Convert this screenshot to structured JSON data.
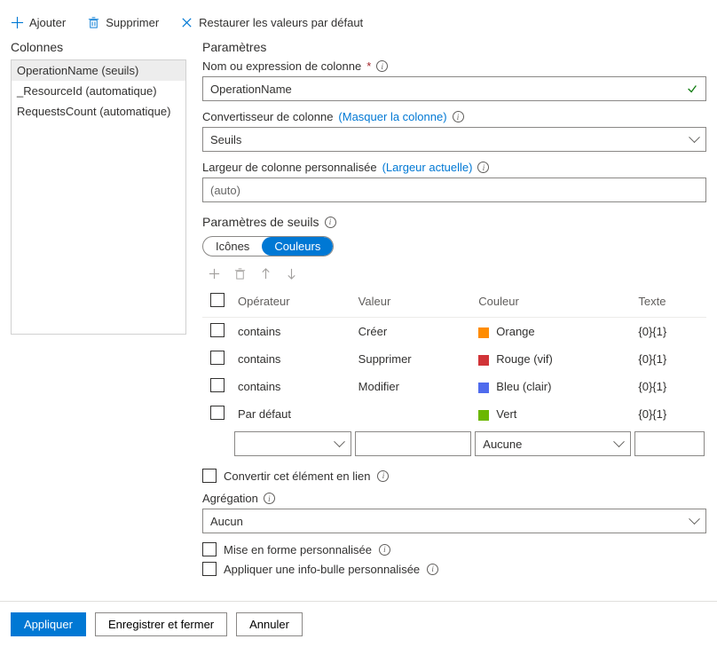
{
  "toolbar": {
    "add_label": "Ajouter",
    "delete_label": "Supprimer",
    "reset_label": "Restaurer les valeurs par défaut"
  },
  "left": {
    "title": "Colonnes",
    "items": [
      {
        "label": "OperationName (seuils)"
      },
      {
        "label": "_ResourceId (automatique)"
      },
      {
        "label": "RequestsCount (automatique)"
      }
    ]
  },
  "params": {
    "title": "Paramètres",
    "col_expr_label": "Nom ou expression de colonne",
    "col_expr_value": "OperationName",
    "converter_label": "Convertisseur de colonne",
    "converter_link": "(Masquer la colonne)",
    "converter_value": "Seuils",
    "width_label": "Largeur de colonne personnalisée",
    "width_link": "(Largeur actuelle)",
    "width_value": "(auto)"
  },
  "thresholds": {
    "title": "Paramètres de seuils",
    "tab_icons": "Icônes",
    "tab_colors": "Couleurs",
    "headers": {
      "op": "Opérateur",
      "val": "Valeur",
      "color": "Couleur",
      "text": "Texte"
    },
    "rows": [
      {
        "op": "contains",
        "val": "Créer",
        "color_name": "Orange",
        "color_hex": "#ff8c00",
        "text": "{0}{1}"
      },
      {
        "op": "contains",
        "val": "Supprimer",
        "color_name": "Rouge (vif)",
        "color_hex": "#d13438",
        "text": "{0}{1}"
      },
      {
        "op": "contains",
        "val": "Modifier",
        "color_name": "Bleu (clair)",
        "color_hex": "#4f6bed",
        "text": "{0}{1}"
      },
      {
        "op": "Par défaut",
        "val": "",
        "color_name": "Vert",
        "color_hex": "#6bb700",
        "text": "{0}{1}"
      }
    ],
    "new_row_color": "Aucune"
  },
  "options": {
    "make_link": "Convertir cet élément en lien",
    "aggregation_label": "Agrégation",
    "aggregation_value": "Aucun",
    "custom_format": "Mise en forme personnalisée",
    "custom_tooltip": "Appliquer une info-bulle personnalisée"
  },
  "footer": {
    "apply": "Appliquer",
    "save_close": "Enregistrer et fermer",
    "cancel": "Annuler"
  }
}
